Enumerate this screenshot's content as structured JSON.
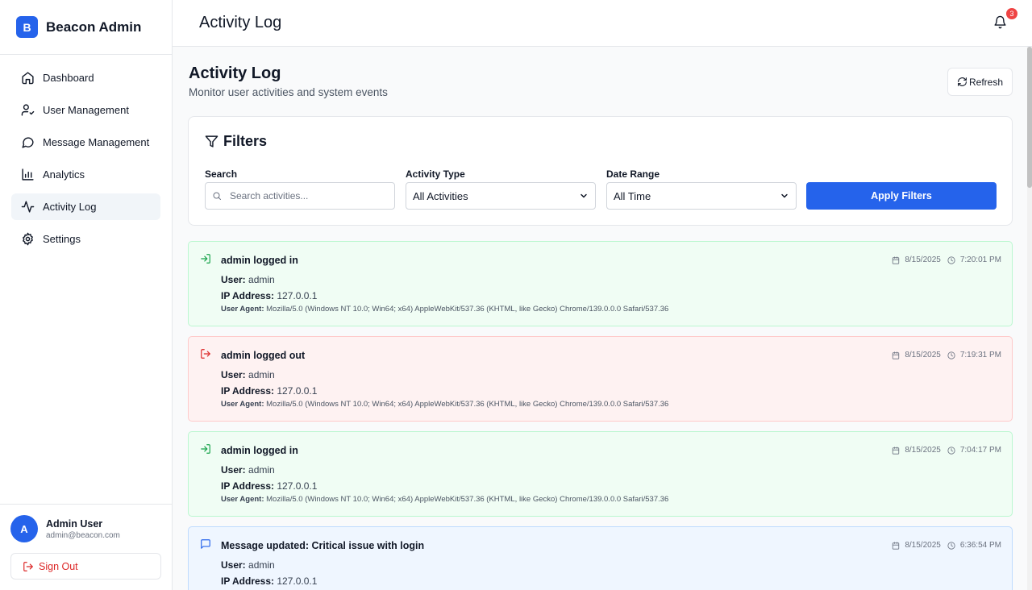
{
  "brand": {
    "logo_letter": "B",
    "name": "Beacon Admin",
    "accent": "#2563eb"
  },
  "nav": [
    {
      "label": "Dashboard",
      "icon": "home-icon",
      "active": false
    },
    {
      "label": "User Management",
      "icon": "user-check-icon",
      "active": false
    },
    {
      "label": "Message Management",
      "icon": "message-circle-icon",
      "active": false
    },
    {
      "label": "Analytics",
      "icon": "bar-chart-icon",
      "active": false
    },
    {
      "label": "Activity Log",
      "icon": "activity-icon",
      "active": true
    },
    {
      "label": "Settings",
      "icon": "gear-icon",
      "active": false
    }
  ],
  "user": {
    "avatar_letter": "A",
    "name": "Admin User",
    "email": "admin@beacon.com",
    "signout_label": "Sign Out"
  },
  "header": {
    "title": "Activity Log",
    "notification_count": "3"
  },
  "page": {
    "title": "Activity Log",
    "subtitle": "Monitor user activities and system events",
    "refresh_label": "Refresh"
  },
  "filters": {
    "heading": "Filters",
    "search": {
      "label": "Search",
      "placeholder": "Search activities..."
    },
    "activity_type": {
      "label": "Activity Type",
      "value": "All Activities"
    },
    "date_range": {
      "label": "Date Range",
      "value": "All Time"
    },
    "apply_label": "Apply Filters"
  },
  "entries": [
    {
      "kind": "login",
      "color": "green",
      "icon": "log-in-icon",
      "title": "admin logged in",
      "user_label": "User:",
      "user": "admin",
      "ip_label": "IP Address:",
      "ip": "127.0.0.1",
      "ua_label": "User Agent:",
      "ua": "Mozilla/5.0 (Windows NT 10.0; Win64; x64) AppleWebKit/537.36 (KHTML, like Gecko) Chrome/139.0.0.0 Safari/537.36",
      "date": "8/15/2025",
      "time": "7:20:01 PM"
    },
    {
      "kind": "logout",
      "color": "red",
      "icon": "log-out-icon",
      "title": "admin logged out",
      "user_label": "User:",
      "user": "admin",
      "ip_label": "IP Address:",
      "ip": "127.0.0.1",
      "ua_label": "User Agent:",
      "ua": "Mozilla/5.0 (Windows NT 10.0; Win64; x64) AppleWebKit/537.36 (KHTML, like Gecko) Chrome/139.0.0.0 Safari/537.36",
      "date": "8/15/2025",
      "time": "7:19:31 PM"
    },
    {
      "kind": "login",
      "color": "green",
      "icon": "log-in-icon",
      "title": "admin logged in",
      "user_label": "User:",
      "user": "admin",
      "ip_label": "IP Address:",
      "ip": "127.0.0.1",
      "ua_label": "User Agent:",
      "ua": "Mozilla/5.0 (Windows NT 10.0; Win64; x64) AppleWebKit/537.36 (KHTML, like Gecko) Chrome/139.0.0.0 Safari/537.36",
      "date": "8/15/2025",
      "time": "7:04:17 PM"
    },
    {
      "kind": "message",
      "color": "blue",
      "icon": "message-square-icon",
      "title": "Message updated: Critical issue with login",
      "user_label": "User:",
      "user": "admin",
      "ip_label": "IP Address:",
      "ip": "127.0.0.1",
      "date": "8/15/2025",
      "time": "6:36:54 PM"
    }
  ]
}
